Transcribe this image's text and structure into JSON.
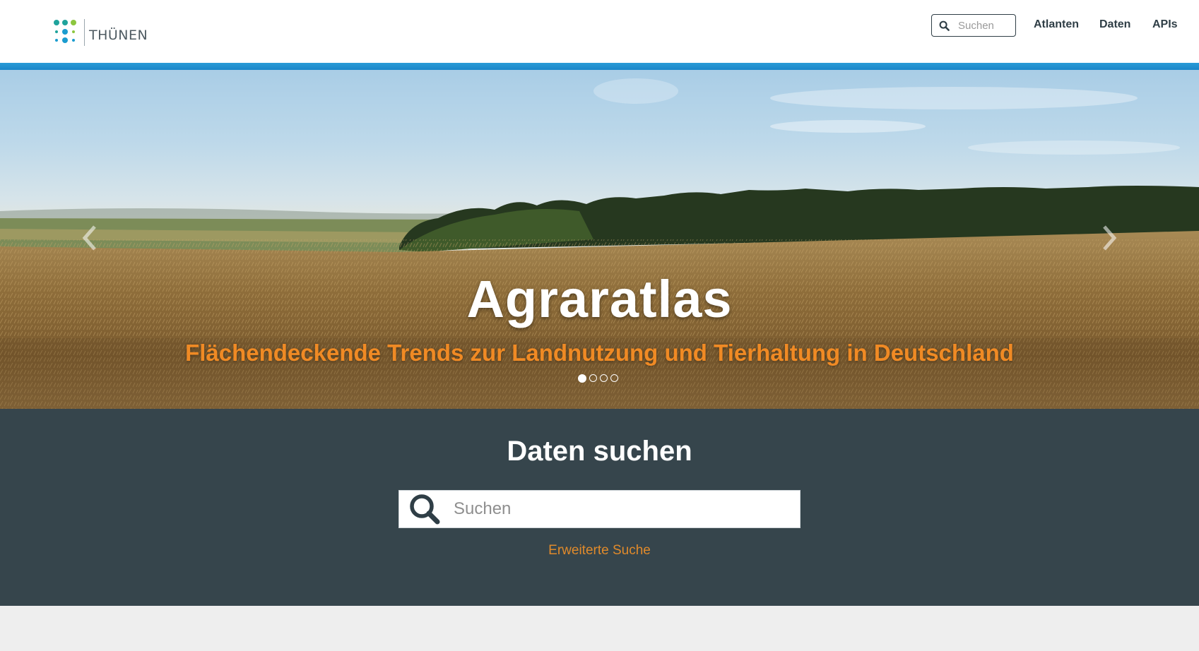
{
  "header": {
    "logo_text": "THÜNEN",
    "search_placeholder": "Suchen",
    "nav": [
      {
        "label": "Atlanten"
      },
      {
        "label": "Daten"
      },
      {
        "label": "APIs"
      }
    ]
  },
  "hero": {
    "title": "Agraratlas",
    "subtitle": "Flächendeckende Trends zur Landnutzung und Tierhaltung in Deutschland",
    "slide_count": 4,
    "active_slide": 1
  },
  "search": {
    "title": "Daten suchen",
    "placeholder": "Suchen",
    "advanced_link": "Erweiterte Suche"
  },
  "colors": {
    "accent_blue": "#1a86c9",
    "accent_orange": "#f08a24",
    "band_dark": "#36454c",
    "text_dark": "#2f3e46"
  }
}
